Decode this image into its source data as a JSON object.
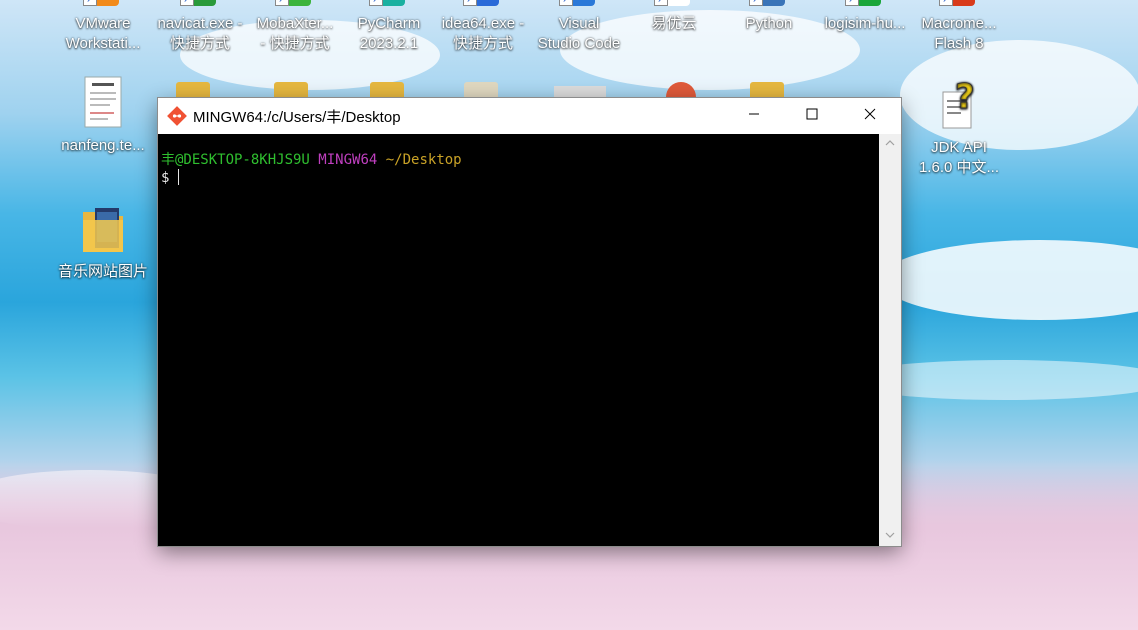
{
  "desktop": {
    "top_icons": [
      {
        "label": "VMware\nWorkstati...",
        "icon": "vmware-icon"
      },
      {
        "label": "navicat.exe -\n快捷方式",
        "icon": "navicat-icon"
      },
      {
        "label": "MobaXter...\n- 快捷方式",
        "icon": "mobaxterm-icon"
      },
      {
        "label": "PyCharm\n2023.2.1",
        "icon": "pycharm-icon"
      },
      {
        "label": "idea64.exe -\n快捷方式",
        "icon": "idea-icon"
      },
      {
        "label": "Visual\nStudio Code",
        "icon": "vscode-icon"
      },
      {
        "label": "易优云",
        "icon": "yiyouyun-icon"
      },
      {
        "label": "Python",
        "icon": "python-icon"
      },
      {
        "label": "logisim-hu...",
        "icon": "logisim-icon"
      },
      {
        "label": "Macrome...\nFlash 8",
        "icon": "flash-icon"
      }
    ],
    "left_icons": [
      {
        "label": "nanfeng.te...",
        "icon": "document-icon"
      },
      {
        "label": "音乐网站图片",
        "icon": "folder-icon"
      }
    ],
    "right_icons": [
      {
        "label": "JDK API\n1.6.0 中文...",
        "icon": "help-file-icon"
      }
    ]
  },
  "window": {
    "title": "MINGW64:/c/Users/丰/Desktop",
    "controls": {
      "minimize": "minimize-icon",
      "maximize": "maximize-icon",
      "close": "close-icon"
    }
  },
  "terminal": {
    "user_host": "丰@DESKTOP-8KHJS9U",
    "env": "MINGW64",
    "path": "~/Desktop",
    "prompt": "$",
    "colors": {
      "user_host": "#2fbf2f",
      "env": "#bf3fbf",
      "path": "#c9a227",
      "text": "#e6e6e6"
    }
  }
}
